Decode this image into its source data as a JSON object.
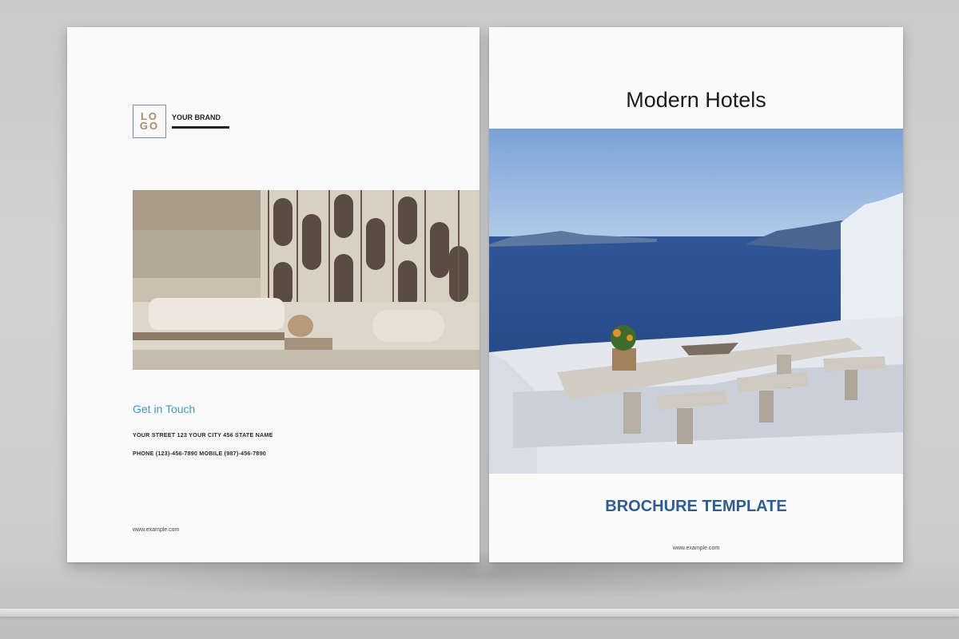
{
  "back_cover": {
    "logo_text": "LOGO",
    "brand_name": "YOUR BRAND",
    "contact_title": "Get in Touch",
    "address": "YOUR STREET 123 YOUR CITY 456 STATE NAME",
    "phone": "PHONE (123)-456-7890 MOBILE (987)-456-7890",
    "website": "www.example.com"
  },
  "front_cover": {
    "title": "Modern Hotels",
    "subtitle": "BROCHURE TEMPLATE",
    "website": "www.example.com"
  },
  "colors": {
    "accent_blue": "#2f5d91",
    "contact_blue": "#3a9ac9",
    "logo_gold": "#a58b69"
  }
}
